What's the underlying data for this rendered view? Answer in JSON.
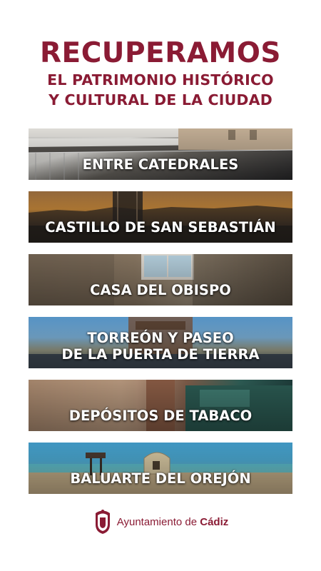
{
  "headline": {
    "line1": "RECUPERAMOS",
    "line2": "EL PATRIMONIO HISTÓRICO",
    "line3": "Y CULTURAL DE LA CIUDAD"
  },
  "cards": [
    {
      "label": "ENTRE CATEDRALES"
    },
    {
      "label": "CASTILLO DE SAN SEBASTIÁN"
    },
    {
      "label": "CASA DEL OBISPO"
    },
    {
      "label_line1": "TORREÓN Y PASEO",
      "label_line2": "DE LA PUERTA DE TIERRA"
    },
    {
      "label": "DEPÓSITOS DE TABACO"
    },
    {
      "label": "BALUARTE DEL OREJÓN"
    }
  ],
  "footer": {
    "brand_prefix": "Ayuntamiento de ",
    "brand_name": "Cádiz",
    "crest_icon": "city-crest-icon"
  },
  "colors": {
    "brand": "#8a1b34",
    "label_text": "#ffffff"
  }
}
